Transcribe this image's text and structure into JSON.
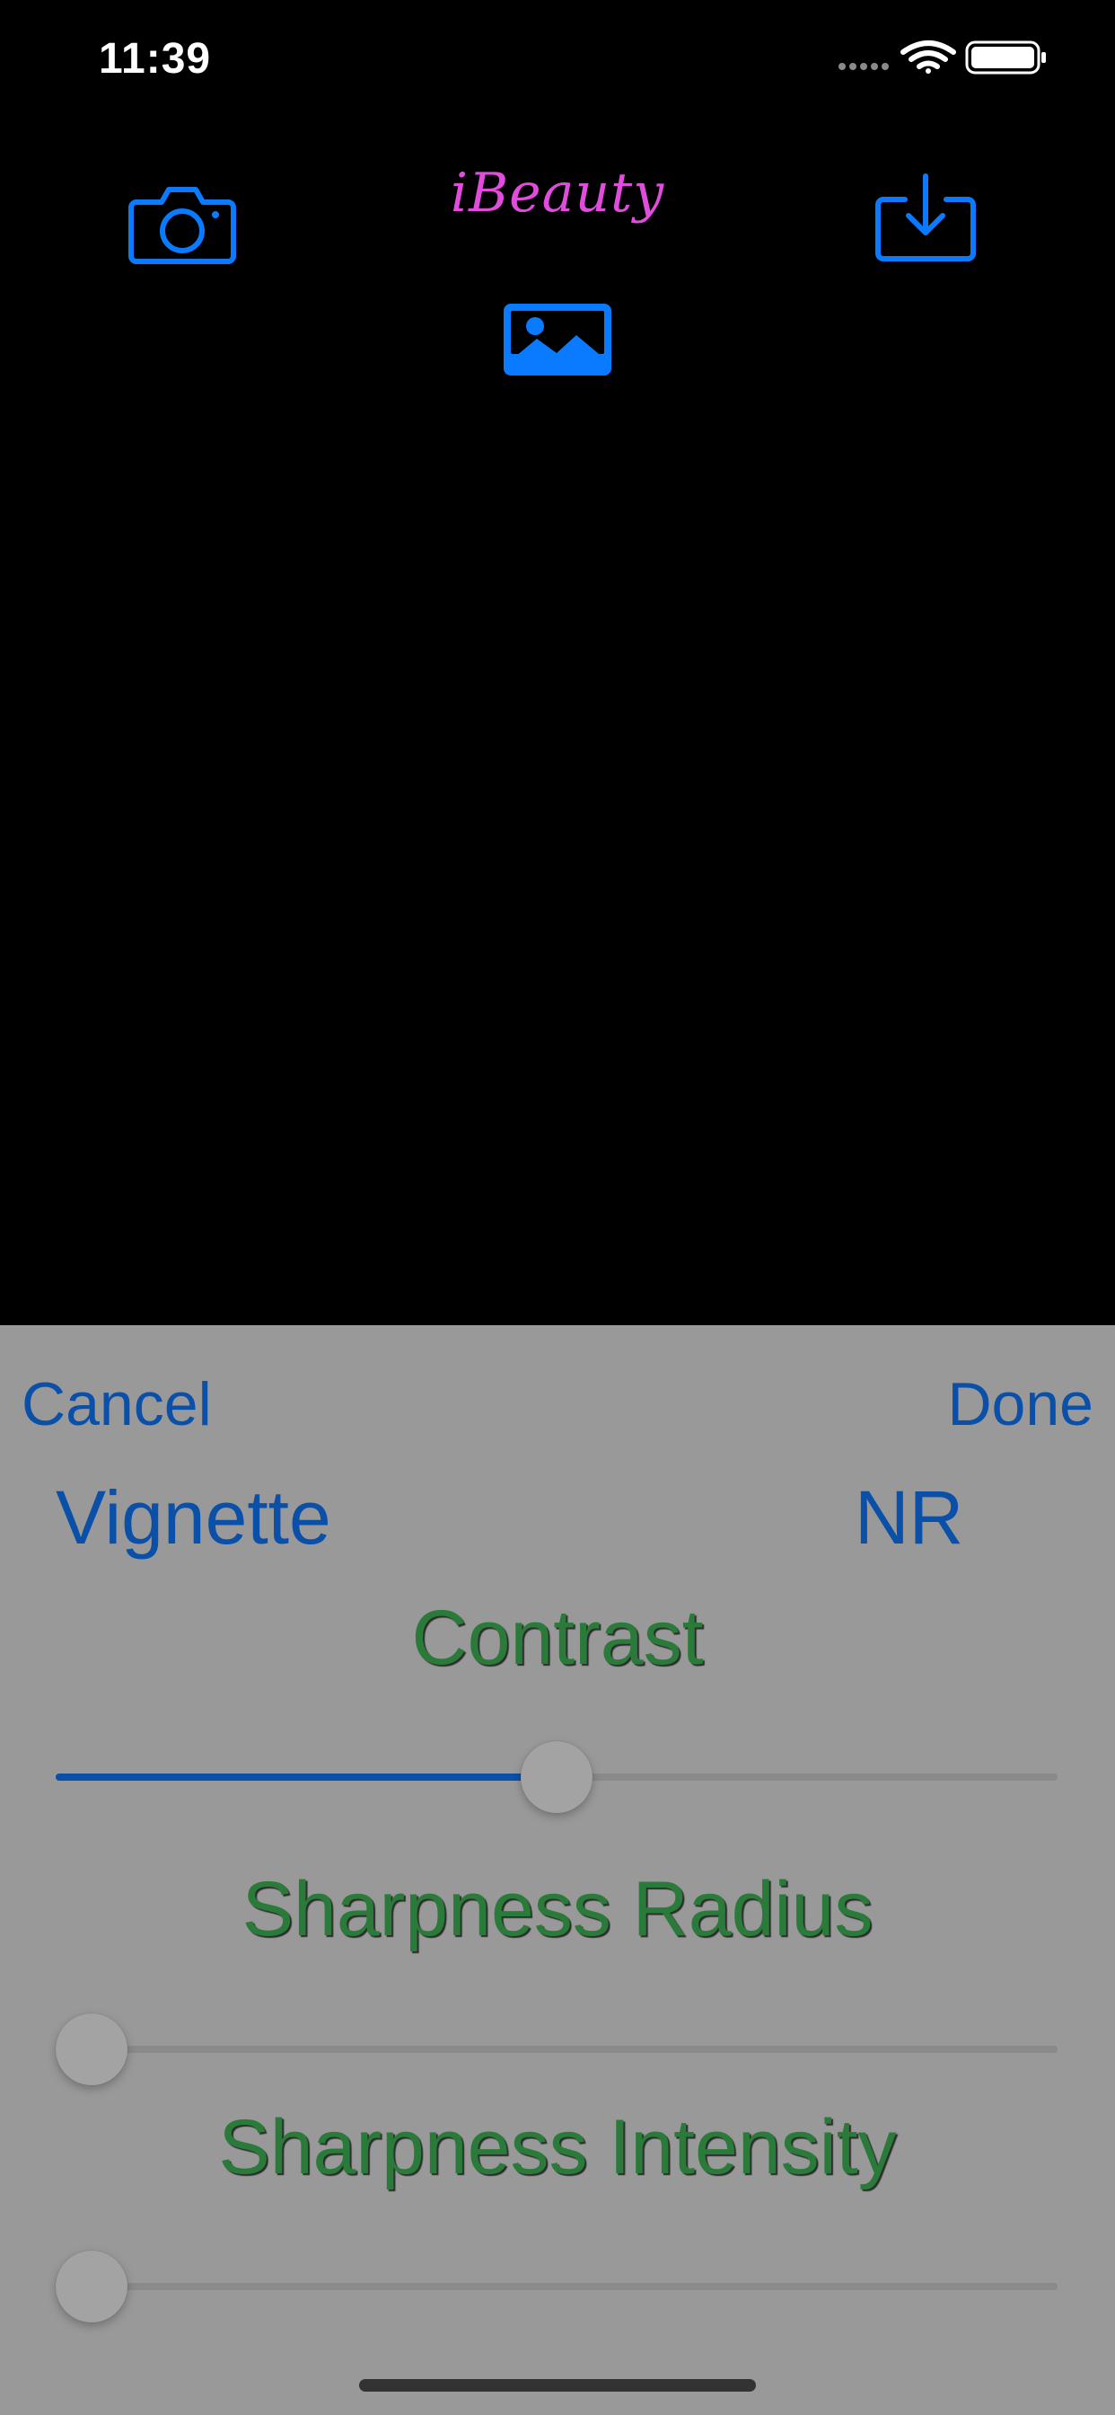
{
  "status_bar": {
    "time": "11:39",
    "icons": [
      "cellular-dots-icon",
      "wifi-icon",
      "battery-icon"
    ]
  },
  "toolbar": {
    "title": "iBeauty",
    "camera_icon": "camera-icon",
    "save_icon": "download-tray-icon",
    "photo_library_icon": "photo-icon"
  },
  "panel": {
    "cancel_label": "Cancel",
    "done_label": "Done",
    "vignette_label": "Vignette",
    "nr_label": "NR",
    "sliders": [
      {
        "label": "Contrast",
        "value": 0.5
      },
      {
        "label": "Sharpness Radius",
        "value": 0.0
      },
      {
        "label": "Sharpness Intensity",
        "value": 0.0
      }
    ]
  },
  "colors": {
    "accent": "#0a7aff",
    "title": "#e04ddc",
    "panel_button": "#0a4fa8",
    "slider_label": "#2a7a3a",
    "panel_background": "#999999",
    "screen_background": "#000000"
  }
}
